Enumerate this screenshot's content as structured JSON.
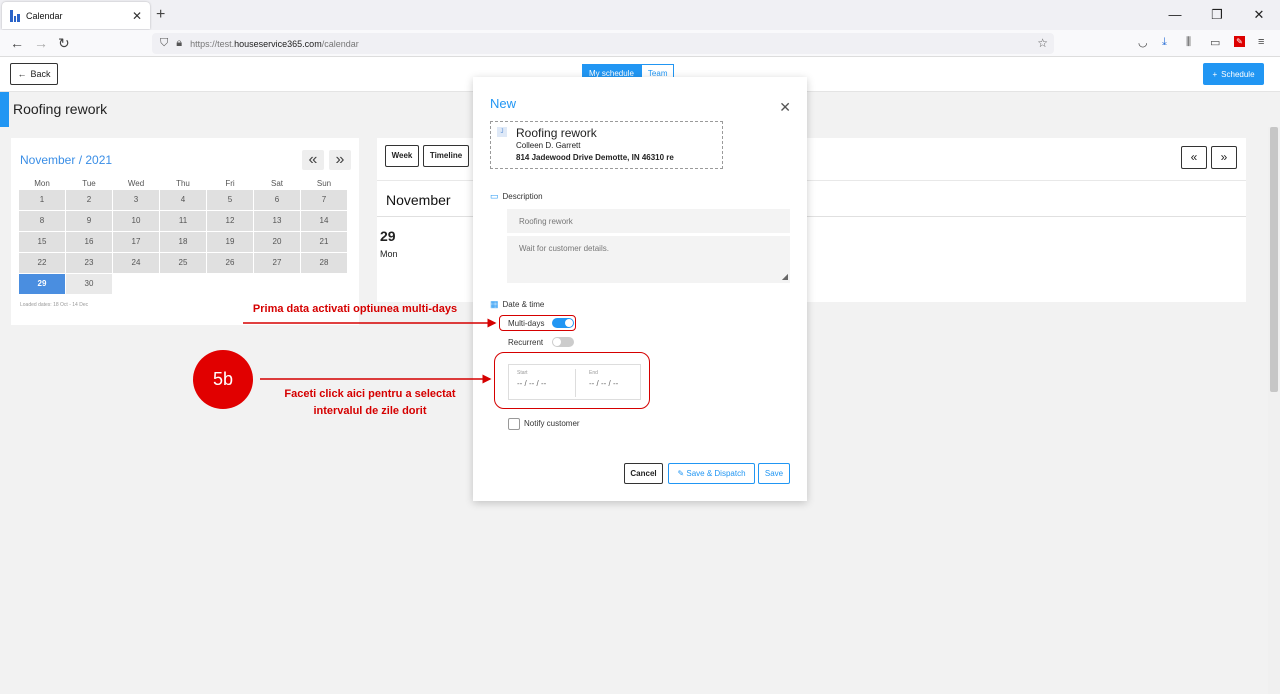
{
  "browser": {
    "tab_title": "Calendar",
    "tab_close": "✕",
    "new_tab": "+",
    "url_prefix": "https://test.",
    "url_domain": "houseservice365.com",
    "url_path": "/calendar"
  },
  "header": {
    "back_label": "Back",
    "view_toggle": [
      "My schedule",
      "Team"
    ],
    "schedule_label": "Schedule"
  },
  "page": {
    "job_title": "Roofing rework"
  },
  "mini_calendar": {
    "month_label": "November / 2021",
    "prev": "«",
    "next": "»",
    "weekdays": [
      "Mon",
      "Tue",
      "Wed",
      "Thu",
      "Fri",
      "Sat",
      "Sun"
    ],
    "days": [
      "1",
      "2",
      "3",
      "4",
      "5",
      "6",
      "7",
      "8",
      "9",
      "10",
      "11",
      "12",
      "13",
      "14",
      "15",
      "16",
      "17",
      "18",
      "19",
      "20",
      "21",
      "22",
      "23",
      "24",
      "25",
      "26",
      "27",
      "28",
      "29",
      "30"
    ],
    "selected_day": "29",
    "loaded_dates": "Loaded dates: 18 Oct - 14 Dec"
  },
  "calendar_panel": {
    "view_buttons": [
      "Week",
      "Timeline"
    ],
    "prev": "«",
    "next": "»",
    "month_header": "November",
    "day_number": "29",
    "day_name": "Mon"
  },
  "modal": {
    "title": "New",
    "close": "✕",
    "job": {
      "avatar_initial": "J",
      "title": "Roofing rework",
      "client": "Colleen D. Garrett",
      "address": "814 Jadewood Drive Demotte, IN 46310 re"
    },
    "description_label": "Description",
    "description_value": "Roofing rework",
    "notes_value": "Wait for customer details.",
    "datetime_label": "Date & time",
    "multidays_label": "Multi-days",
    "multidays_on": true,
    "recurrent_label": "Recurrent",
    "recurrent_on": false,
    "start_label": "Start",
    "start_value": "-- / -- / --",
    "end_label": "End",
    "end_value": "-- / -- / --",
    "notify_label": "Notify customer",
    "cancel_label": "Cancel",
    "dispatch_label": "Save & Dispatch",
    "save_label": "Save"
  },
  "annotations": {
    "step_badge": "5b",
    "note_multidays": "Prima data activati optiunea multi-days",
    "note_click_line1": "Faceti click aici pentru a selectat",
    "note_click_line2": "intervalul de zile dorit",
    "color": "#d50000"
  },
  "colors": {
    "accent": "#2196f3",
    "selected_day": "#4a8ee0"
  }
}
